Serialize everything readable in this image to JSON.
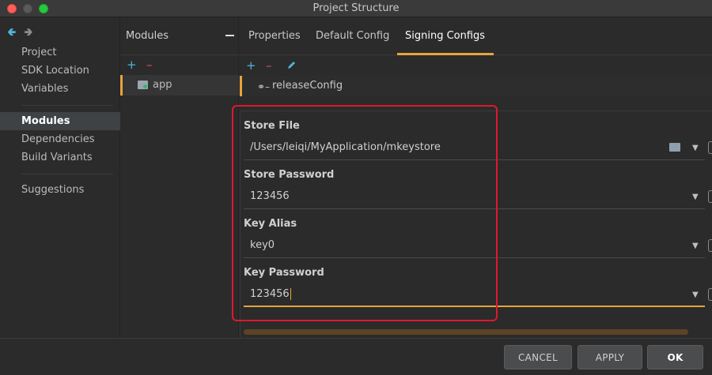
{
  "window": {
    "title": "Project Structure"
  },
  "nav": {
    "items": [
      {
        "label": "Project",
        "active": false
      },
      {
        "label": "SDK Location",
        "active": false
      },
      {
        "label": "Variables",
        "active": false
      },
      {
        "label": "Modules",
        "active": true
      },
      {
        "label": "Dependencies",
        "active": false
      },
      {
        "label": "Build Variants",
        "active": false
      },
      {
        "label": "Suggestions",
        "active": false
      }
    ]
  },
  "modules": {
    "title": "Modules",
    "items": [
      {
        "label": "app"
      }
    ]
  },
  "tabs": [
    {
      "label": "Properties",
      "active": false
    },
    {
      "label": "Default Config",
      "active": false
    },
    {
      "label": "Signing Configs",
      "active": true
    }
  ],
  "signing": {
    "configs": [
      {
        "label": "releaseConfig"
      }
    ],
    "store_file": {
      "label": "Store File",
      "value": "/Users/leiqi/MyApplication/mkeystore"
    },
    "store_password": {
      "label": "Store Password",
      "value": "123456"
    },
    "key_alias": {
      "label": "Key Alias",
      "value": "key0"
    },
    "key_password": {
      "label": "Key Password",
      "value": "123456"
    }
  },
  "buttons": {
    "cancel": "CANCEL",
    "apply": "APPLY",
    "ok": "OK"
  },
  "icons": {
    "back": "arrow-back-icon",
    "forward": "arrow-forward-icon",
    "add": "plus-icon",
    "remove": "minus-icon",
    "edit": "pencil-icon",
    "folder": "module-folder-icon",
    "key": "key-icon",
    "browse": "folder-open-icon",
    "dropdown": "chevron-down-icon"
  },
  "colors": {
    "accent": "#e8a33c",
    "add": "#4fb5d8",
    "remove": "#e05252",
    "highlight": "#e0182d",
    "background": "#2b2b2b"
  }
}
